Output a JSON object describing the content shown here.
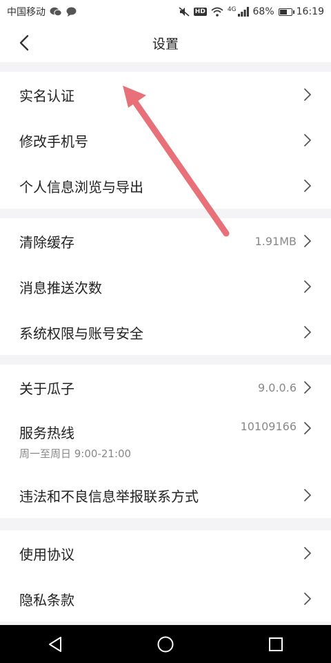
{
  "status_bar": {
    "carrier": "中国移动",
    "network": "4G",
    "hd": "HD",
    "battery": "68%",
    "battery_level": 0.68,
    "time": "16:19",
    "left_icons": [
      "wechat-icon",
      "chat-bubble-icon"
    ],
    "right_icons": [
      "mute-icon",
      "hd-icon",
      "wifi-icon",
      "signal-icon",
      "battery-icon"
    ]
  },
  "header": {
    "title": "设置"
  },
  "groups": [
    {
      "items": [
        {
          "label": "实名认证"
        },
        {
          "label": "修改手机号"
        },
        {
          "label": "个人信息浏览与导出"
        }
      ]
    },
    {
      "items": [
        {
          "label": "清除缓存",
          "value": "1.91MB"
        },
        {
          "label": "消息推送次数"
        },
        {
          "label": "系统权限与账号安全"
        }
      ]
    },
    {
      "items": [
        {
          "label": "关于瓜子",
          "value": "9.0.0.6"
        },
        {
          "label": "服务热线",
          "value": "10109166",
          "sub": "周一至周日 9:00-21:00"
        },
        {
          "label": "违法和不良信息举报联系方式"
        }
      ]
    },
    {
      "items": [
        {
          "label": "使用协议"
        },
        {
          "label": "隐私条款"
        }
      ]
    }
  ],
  "colors": {
    "arrow": "#e87078",
    "divider_bg": "#f4f4f6",
    "text_primary": "#222222",
    "text_secondary": "#888888"
  },
  "nav_bar": {
    "buttons": [
      "back-triangle-icon",
      "home-circle-icon",
      "recents-square-icon"
    ]
  }
}
